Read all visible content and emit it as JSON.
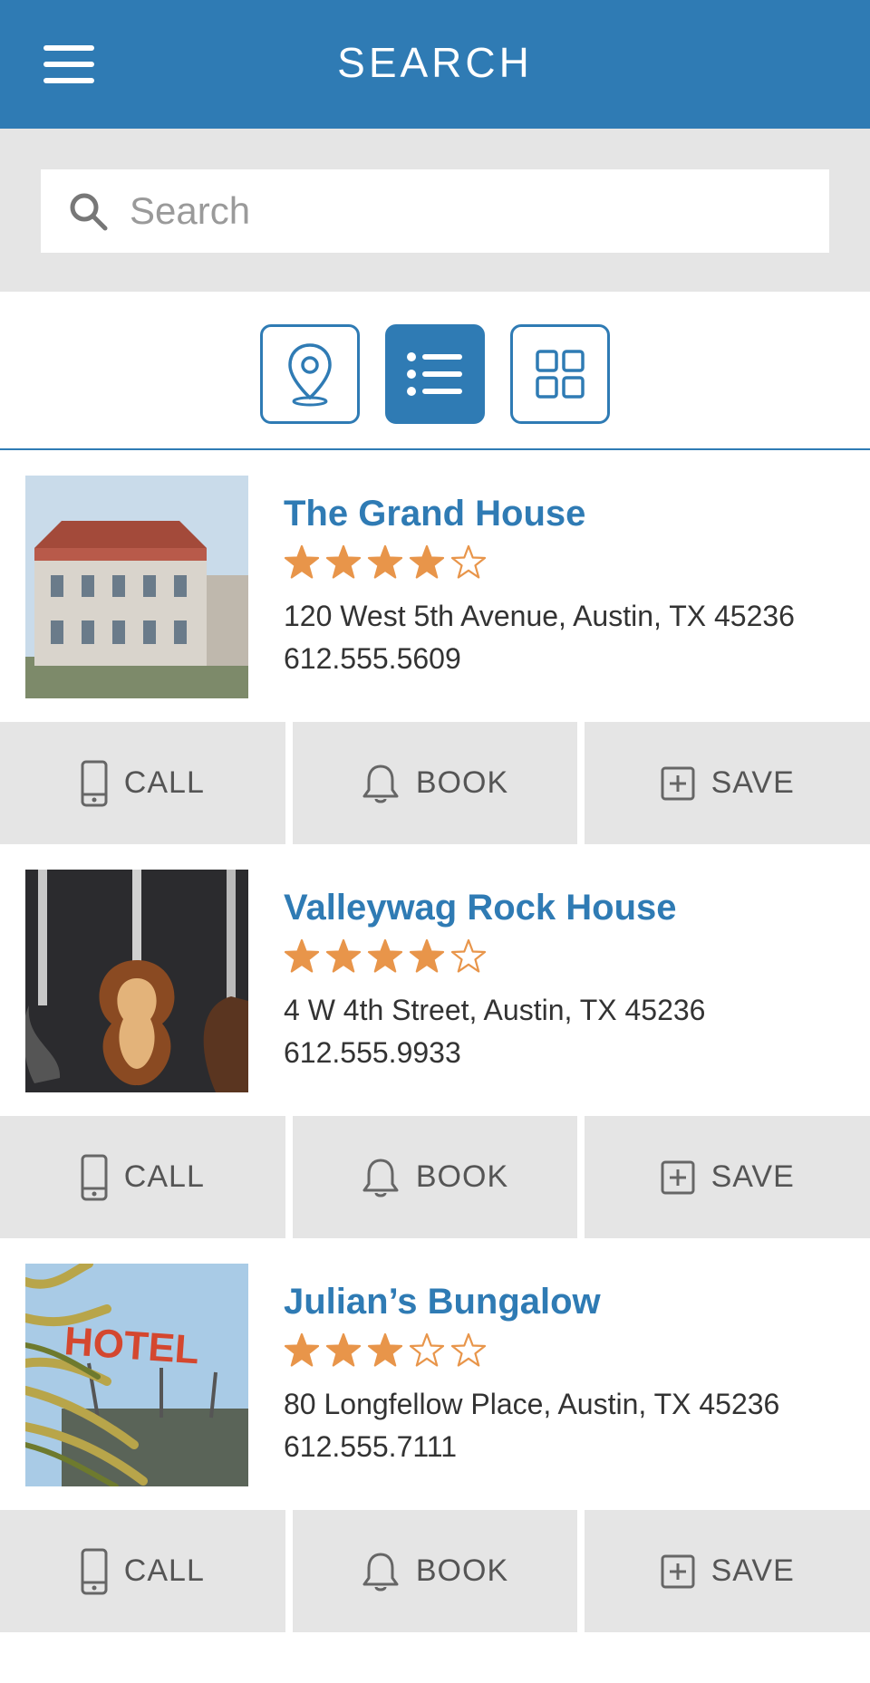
{
  "header": {
    "title": "SEARCH"
  },
  "search": {
    "placeholder": "Search"
  },
  "view_toggle": {
    "active": "list"
  },
  "colors": {
    "brand": "#2f7bb4",
    "star": "#e8954a",
    "panel": "#e5e5e5"
  },
  "listings": [
    {
      "name": "The Grand House",
      "rating": 4,
      "address": "120 West 5th Avenue, Austin, TX 45236",
      "phone": "612.555.5609",
      "image": "historic-mansion-photo"
    },
    {
      "name": "Valleywag Rock House",
      "rating": 4,
      "address": "4 W 4th Street, Austin, TX 45236",
      "phone": "612.555.9933",
      "image": "guitars-photo"
    },
    {
      "name": "Julian’s Bungalow",
      "rating": 3,
      "address": "80 Longfellow Place, Austin, TX 45236",
      "phone": "612.555.7111",
      "image": "hotel-sign-photo"
    }
  ],
  "actions": {
    "call": "CALL",
    "book": "BOOK",
    "save": "SAVE"
  }
}
